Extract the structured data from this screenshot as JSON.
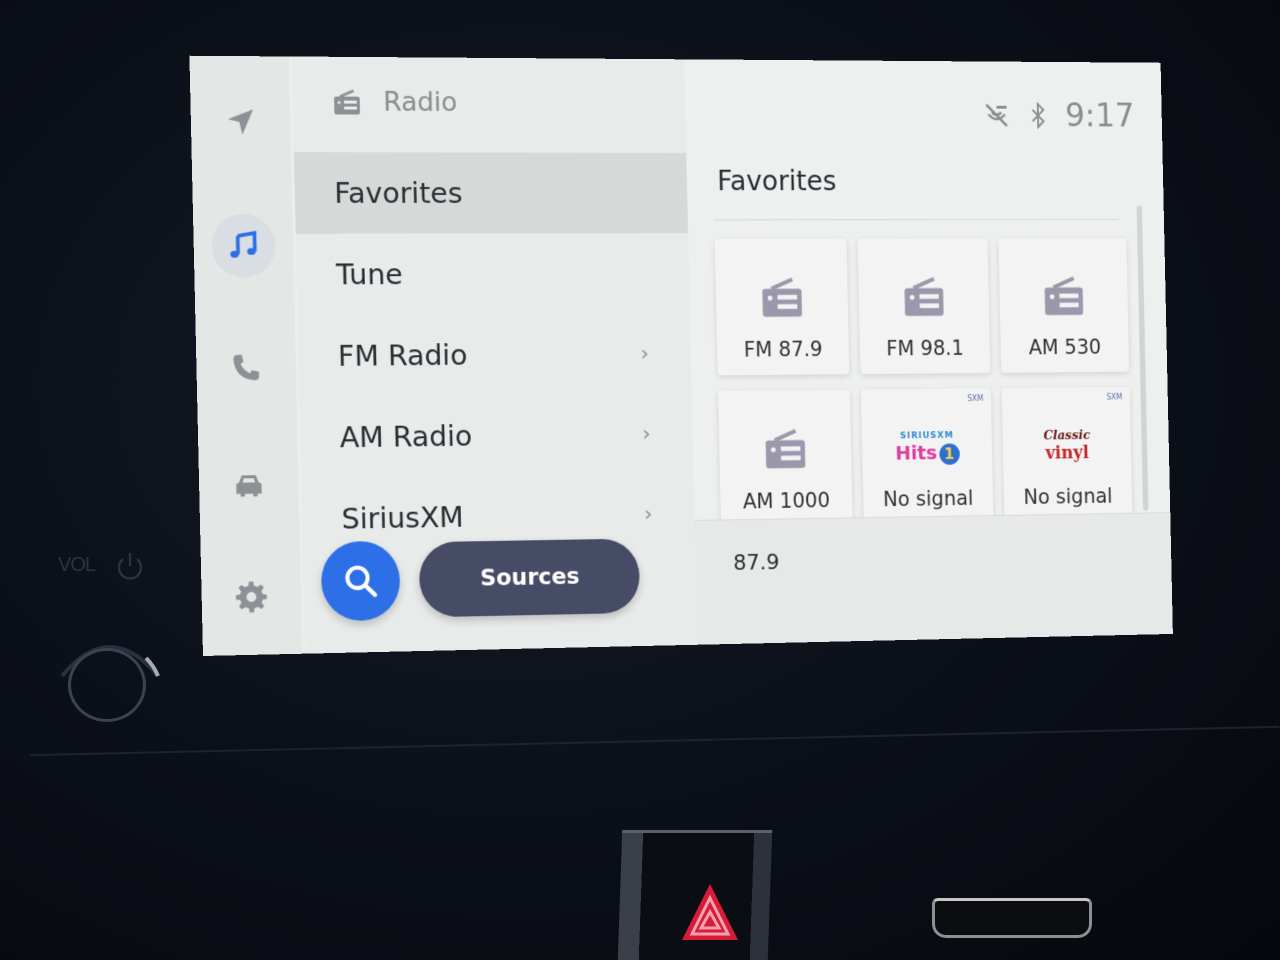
{
  "app": {
    "title": "Radio",
    "title_icon": "radio-icon"
  },
  "rail": {
    "items": [
      {
        "name": "navigation",
        "icon": "navigation-arrow-icon",
        "active": false
      },
      {
        "name": "music",
        "icon": "music-note-icon",
        "active": true
      },
      {
        "name": "phone",
        "icon": "phone-icon",
        "active": false
      },
      {
        "name": "vehicle",
        "icon": "car-icon",
        "active": false
      },
      {
        "name": "settings",
        "icon": "gear-icon",
        "active": false
      }
    ]
  },
  "menu": {
    "items": [
      {
        "label": "Favorites",
        "selected": true,
        "has_submenu": false
      },
      {
        "label": "Tune",
        "selected": false,
        "has_submenu": false
      },
      {
        "label": "FM Radio",
        "selected": false,
        "has_submenu": true
      },
      {
        "label": "AM Radio",
        "selected": false,
        "has_submenu": true
      },
      {
        "label": "SiriusXM",
        "selected": false,
        "has_submenu": true
      }
    ],
    "chevron": "›",
    "search_icon": "search-icon",
    "sources_label": "Sources"
  },
  "status": {
    "icons": [
      "mic-muted-icon",
      "bluetooth-icon"
    ],
    "time": "9:17"
  },
  "favorites": {
    "title": "Favorites",
    "tiles": [
      {
        "label": "FM 87.9",
        "type": "radio"
      },
      {
        "label": "FM 98.1",
        "type": "radio"
      },
      {
        "label": "AM 530",
        "type": "radio"
      },
      {
        "label": "AM 1000",
        "type": "radio"
      },
      {
        "label": "No signal",
        "type": "siriusxm",
        "logo_top": "SIRIUSXM",
        "logo_main": "Hits",
        "logo_badge": "1",
        "badge": "SXM"
      },
      {
        "label": "No signal",
        "type": "siriusxm",
        "logo_top": "Classic",
        "logo_main": "vinyl",
        "badge": "SXM"
      }
    ]
  },
  "now_playing": {
    "frequency": "87.9"
  },
  "hardware": {
    "volume_label": "VOL"
  },
  "colors": {
    "accent": "#2d6fe6",
    "sources_button": "#474c66",
    "text": "#2a2c33",
    "muted": "#8b8d91"
  }
}
